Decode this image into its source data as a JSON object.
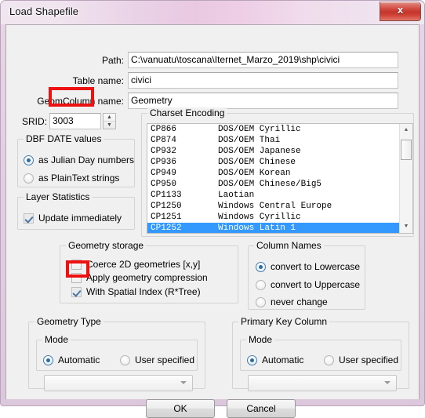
{
  "window": {
    "title": "Load Shapefile",
    "close_glyph": "x",
    "accent_red": "#ee1111",
    "selection_blue": "#3399ff"
  },
  "fields": {
    "path": {
      "label": "Path:",
      "value": "C:\\vanuatu\\toscana\\Iternet_Marzo_2019\\shp\\civici"
    },
    "table_name": {
      "label": "Table name:",
      "value": "civici"
    },
    "geom_column": {
      "label": "GeomColumn name:",
      "value": "Geometry"
    },
    "srid": {
      "label": "SRID:",
      "value": "3003",
      "spin_up": "▲",
      "spin_down": "▼"
    }
  },
  "dbf_date": {
    "title": "DBF DATE values",
    "options": [
      {
        "label": "as Julian Day numbers",
        "selected": true
      },
      {
        "label": "as PlainText strings",
        "selected": false
      }
    ]
  },
  "layer_statistics": {
    "title": "Layer Statistics",
    "checkbox": {
      "label": "Update immediately",
      "checked": true
    }
  },
  "charset": {
    "title": "Charset Encoding",
    "rows": [
      {
        "code": "CP866",
        "desc": "DOS/OEM Cyrillic",
        "selected": false
      },
      {
        "code": "CP874",
        "desc": "DOS/OEM Thai",
        "selected": false
      },
      {
        "code": "CP932",
        "desc": "DOS/OEM Japanese",
        "selected": false
      },
      {
        "code": "CP936",
        "desc": "DOS/OEM Chinese",
        "selected": false
      },
      {
        "code": "CP949",
        "desc": "DOS/OEM Korean",
        "selected": false
      },
      {
        "code": "CP950",
        "desc": "DOS/OEM Chinese/Big5",
        "selected": false
      },
      {
        "code": "CP1133",
        "desc": "Laotian",
        "selected": false
      },
      {
        "code": "CP1250",
        "desc": "Windows Central Europe",
        "selected": false
      },
      {
        "code": "CP1251",
        "desc": "Windows Cyrillic",
        "selected": false
      },
      {
        "code": "CP1252",
        "desc": "Windows Latin 1",
        "selected": true
      }
    ],
    "scroll_up": "▲",
    "scroll_down": "▼"
  },
  "geometry_storage": {
    "title": "Geometry storage",
    "checkboxes": [
      {
        "label": "Coerce 2D geometries [x,y]",
        "checked": false
      },
      {
        "label": "Apply geometry compression",
        "checked": false
      },
      {
        "label": "With Spatial Index (R*Tree)",
        "checked": true
      }
    ]
  },
  "column_names": {
    "title": "Column Names",
    "options": [
      {
        "label": "convert to Lowercase",
        "selected": true
      },
      {
        "label": "convert to Uppercase",
        "selected": false
      },
      {
        "label": "never change",
        "selected": false
      }
    ]
  },
  "geometry_type": {
    "title": "Geometry Type",
    "mode_title": "Mode",
    "options": [
      {
        "label": "Automatic",
        "selected": true
      },
      {
        "label": "User specified",
        "selected": false
      }
    ],
    "combo_value": ""
  },
  "primary_key": {
    "title": "Primary Key Column",
    "mode_title": "Mode",
    "options": [
      {
        "label": "Automatic",
        "selected": true
      },
      {
        "label": "User specified",
        "selected": false
      }
    ],
    "combo_value": ""
  },
  "buttons": {
    "ok": "OK",
    "cancel": "Cancel"
  }
}
